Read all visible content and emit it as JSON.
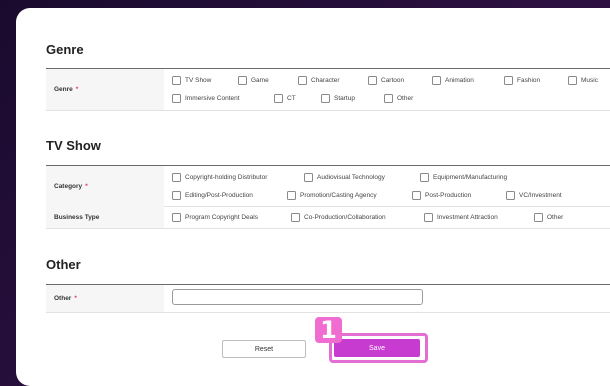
{
  "sections": {
    "genre": {
      "title": "Genre",
      "row_label": "Genre",
      "options_row1": [
        "TV Show",
        "Game",
        "Character",
        "Cartoon",
        "Animation",
        "Fashion",
        "Music"
      ],
      "options_row2": [
        "Immersive Content",
        "CT",
        "Startup",
        "Other"
      ]
    },
    "tvshow": {
      "title": "TV Show",
      "category_label": "Category",
      "category_row1": [
        "Copyright-holding Distributor",
        "Audiovisual Technology",
        "Equipment/Manufacturing"
      ],
      "category_row2": [
        "Editing/Post-Production",
        "Promotion/Casting Agency",
        "Post-Production",
        "VC/Investment"
      ],
      "business_label": "Business Type",
      "business_options": [
        "Program Copyright Deals",
        "Co-Production/Collaboration",
        "Investment Attraction",
        "Other"
      ]
    },
    "other": {
      "title": "Other",
      "row_label": "Other",
      "input_value": ""
    }
  },
  "required_marker": "*",
  "buttons": {
    "reset": "Reset",
    "save": "Save"
  },
  "step_badge": "1",
  "colors": {
    "accent": "#c73bd0",
    "highlight": "#e36fd2",
    "required": "#e8336e"
  }
}
